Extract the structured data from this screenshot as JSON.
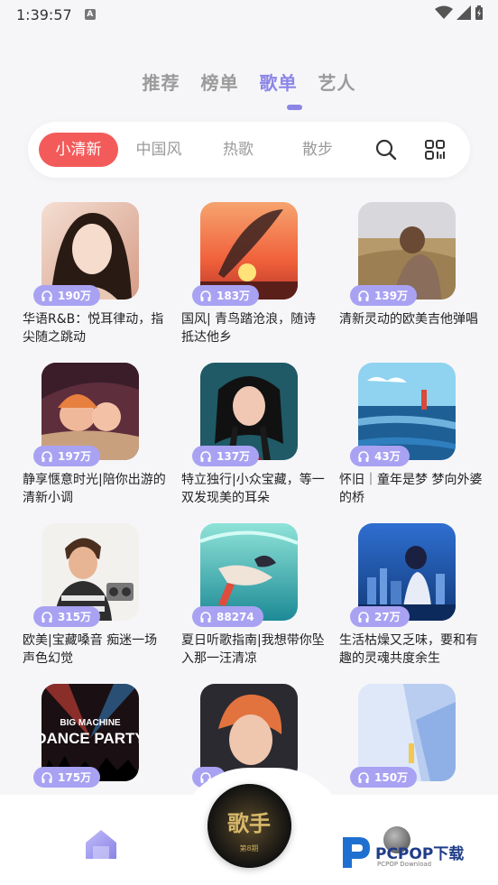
{
  "status": {
    "time": "1:39:57",
    "notif_letter": "A"
  },
  "top_tabs": [
    {
      "label": "推荐",
      "active": false
    },
    {
      "label": "榜单",
      "active": false
    },
    {
      "label": "歌单",
      "active": true
    },
    {
      "label": "艺人",
      "active": false
    }
  ],
  "filter_chips": [
    {
      "label": "小清新",
      "active": true
    },
    {
      "label": "中国风",
      "active": false
    },
    {
      "label": "热歌",
      "active": false
    },
    {
      "label": "散步",
      "active": false
    }
  ],
  "playlists": [
    {
      "title": "华语R&B：悦耳律动，指尖随之跳动",
      "plays": "190万",
      "art": "portrait-girl"
    },
    {
      "title": "国风| 青鸟踏沧浪，随诗抵达他乡",
      "plays": "183万",
      "art": "feather-sunset"
    },
    {
      "title": "清新灵动的欧美吉他弹唱",
      "plays": "139万",
      "art": "field-girl"
    },
    {
      "title": "静享惬意时光|陪你出游的清新小调",
      "plays": "197万",
      "art": "car-anime"
    },
    {
      "title": "特立独行|小众宝藏，等一双发现美的耳朵",
      "plays": "137万",
      "art": "braids-girl"
    },
    {
      "title": "怀旧｜童年是梦 梦向外婆的桥",
      "plays": "43万",
      "art": "sea-painting"
    },
    {
      "title": "欧美|宝藏嗓音 痴迷一场声色幻觉",
      "plays": "315万",
      "art": "guy-boombox"
    },
    {
      "title": "夏日听歌指南|我想带你坠入那一汪清凉",
      "plays": "88274",
      "art": "underwater"
    },
    {
      "title": "生活枯燥又乏味，要和有趣的灵魂共度余生",
      "plays": "27万",
      "art": "city-night"
    },
    {
      "title": "",
      "plays": "175万",
      "art": "dance-party",
      "art_text_1": "BIG MACHINE",
      "art_text_2": "DANCE PARTY"
    },
    {
      "title": "",
      "plays": "",
      "art": "orange-hair"
    },
    {
      "title": "",
      "plays": "150万",
      "art": "blue-abstract"
    }
  ],
  "bottom_nav": {
    "disc_text": "歌手",
    "disc_sub": "第8期"
  },
  "watermark": {
    "brand": "PCPOP下载",
    "sub": "PCPOP Download"
  },
  "colors": {
    "accent": "#8c85e6",
    "chip_active": "#f35b5b",
    "badge": "#a9a2f3"
  }
}
